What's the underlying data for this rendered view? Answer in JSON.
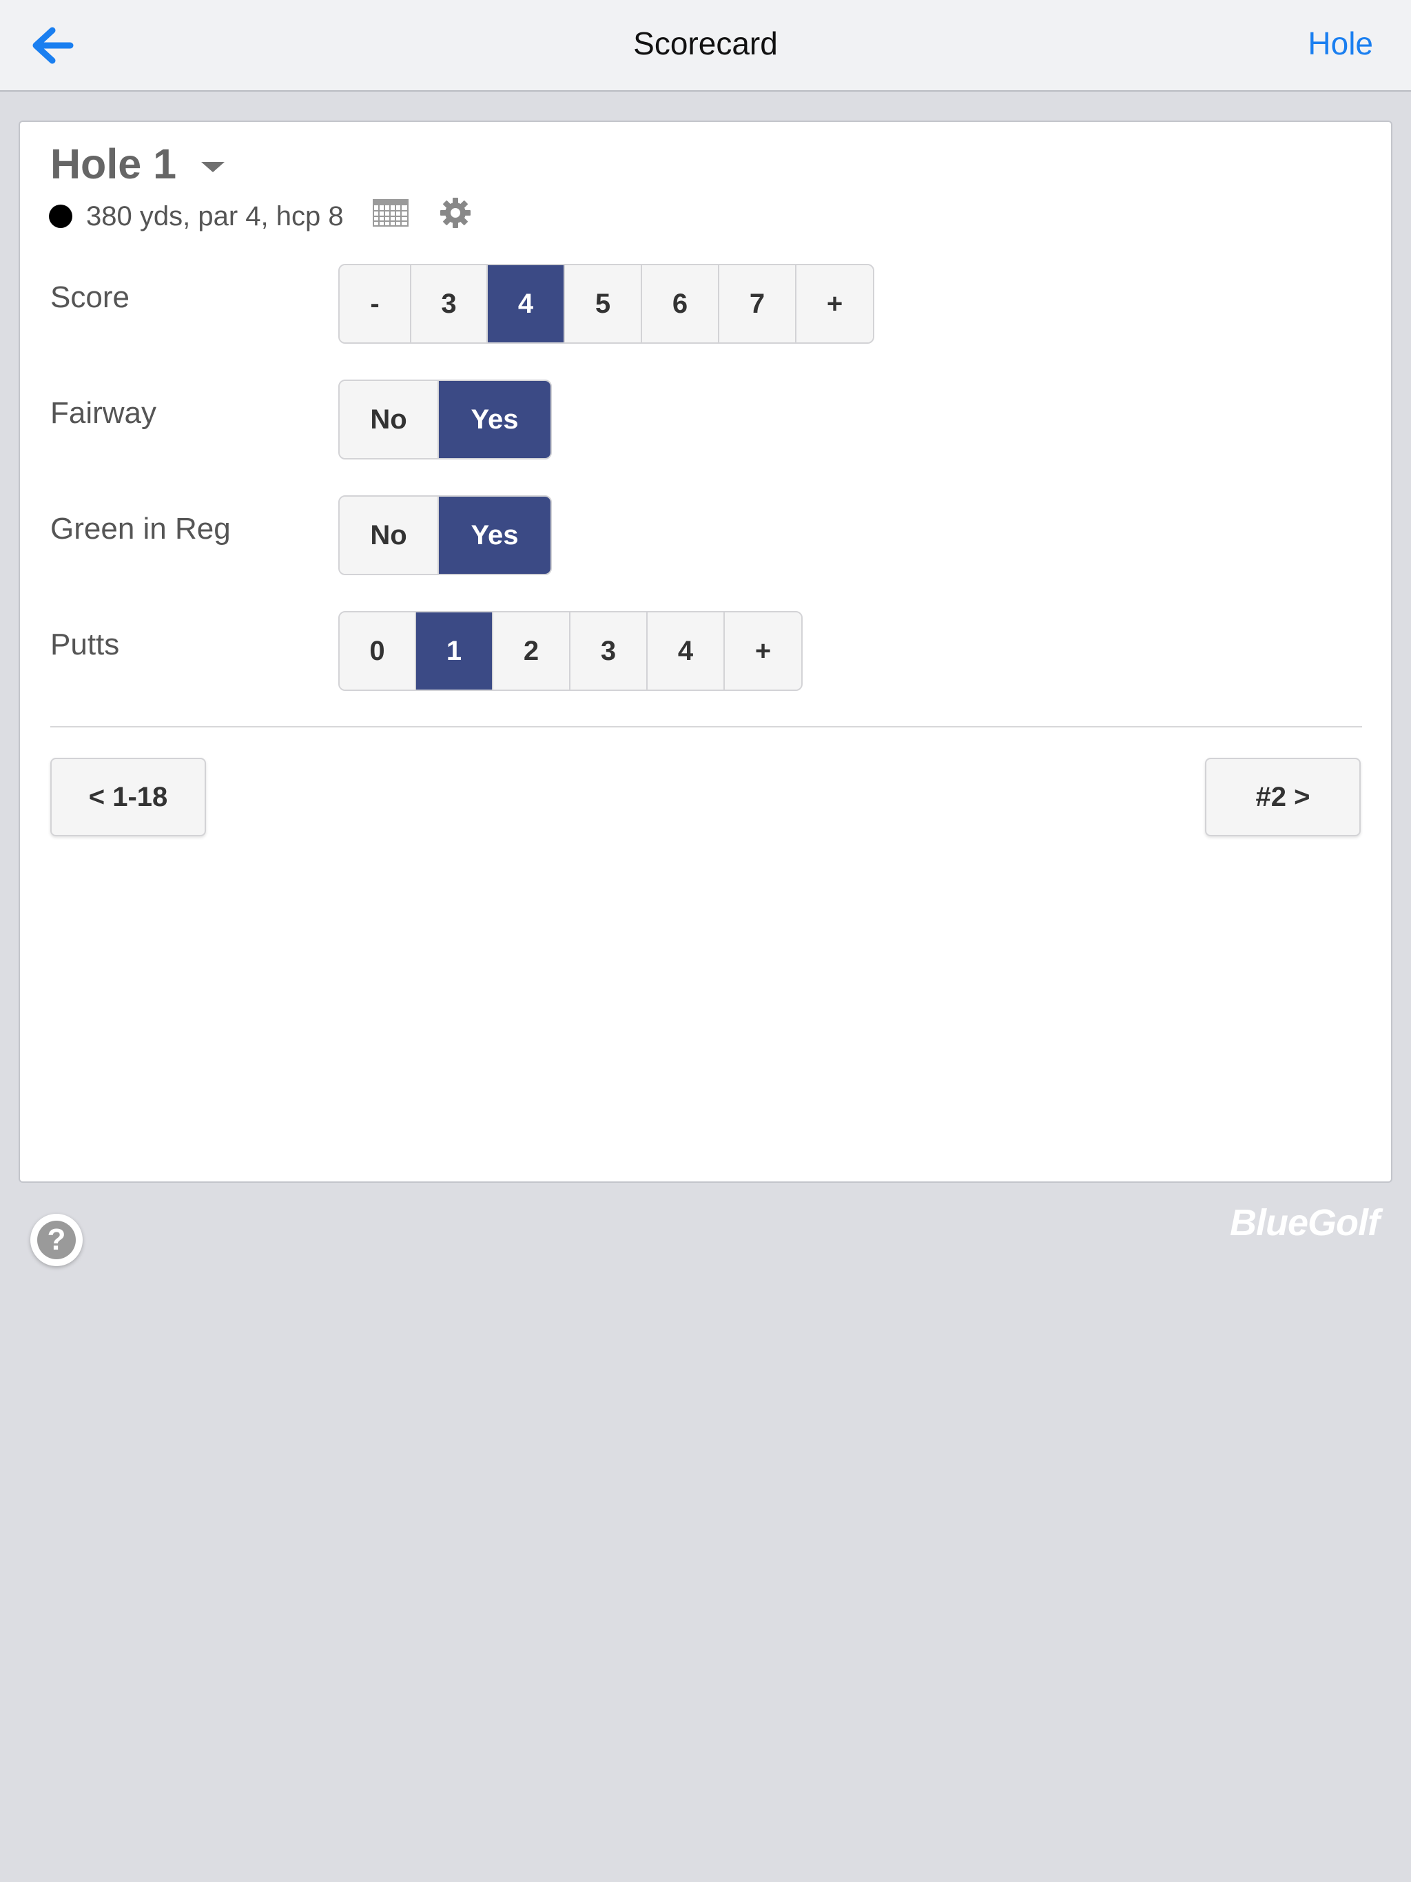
{
  "navbar": {
    "back_icon": "back-arrow-icon",
    "title": "Scorecard",
    "right_label": "Hole"
  },
  "hole": {
    "title": "Hole 1",
    "info": "380 yds, par 4, hcp 8",
    "tee_color": "#000000"
  },
  "score": {
    "label": "Score",
    "options": [
      "-",
      "3",
      "4",
      "5",
      "6",
      "7",
      "+"
    ],
    "selected": "4"
  },
  "fairway": {
    "label": "Fairway",
    "options": [
      "No",
      "Yes"
    ],
    "selected": "Yes"
  },
  "gir": {
    "label": "Green in Reg",
    "options": [
      "No",
      "Yes"
    ],
    "selected": "Yes"
  },
  "putts": {
    "label": "Putts",
    "options": [
      "0",
      "1",
      "2",
      "3",
      "4",
      "+"
    ],
    "selected": "1"
  },
  "nav": {
    "prev_label": "< 1-18",
    "next_label": "#2 >"
  },
  "footer": {
    "help_symbol": "?",
    "brand": "BlueGolf"
  },
  "colors": {
    "accent": "#1a7ff0",
    "selected": "#3b4a85",
    "background": "#dcdde2"
  }
}
